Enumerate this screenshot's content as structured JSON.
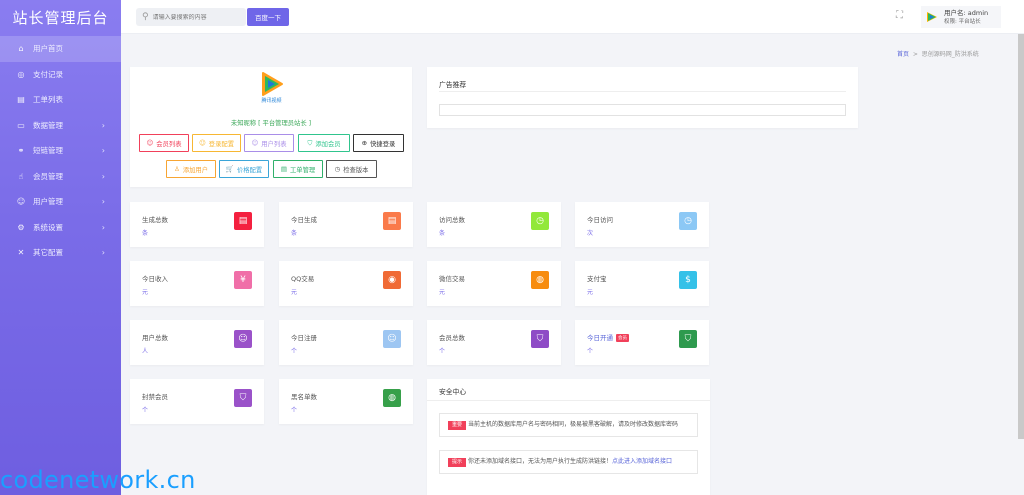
{
  "app": {
    "title": "站长管理后台"
  },
  "sidebar": {
    "items": [
      {
        "label": "用户首页",
        "icon": "⌂",
        "icon_name": "home-icon",
        "active": true,
        "has_children": false
      },
      {
        "label": "支付记录",
        "icon": "◎",
        "icon_name": "payment-icon",
        "active": false,
        "has_children": false
      },
      {
        "label": "工单列表",
        "icon": "▤",
        "icon_name": "ticket-icon",
        "active": false,
        "has_children": false
      },
      {
        "label": "数据管理",
        "icon": "▭",
        "icon_name": "data-icon",
        "active": false,
        "has_children": true
      },
      {
        "label": "短链管理",
        "icon": "⚭",
        "icon_name": "link-icon",
        "active": false,
        "has_children": true
      },
      {
        "label": "会员管理",
        "icon": "☝",
        "icon_name": "member-icon",
        "active": false,
        "has_children": true
      },
      {
        "label": "用户管理",
        "icon": "☺",
        "icon_name": "user-icon",
        "active": false,
        "has_children": true
      },
      {
        "label": "系统设置",
        "icon": "⚙",
        "icon_name": "settings-icon",
        "active": false,
        "has_children": true
      },
      {
        "label": "其它配置",
        "icon": "✕",
        "icon_name": "tools-icon",
        "active": false,
        "has_children": true
      }
    ]
  },
  "topbar": {
    "search_placeholder": "请输入要搜索的内容",
    "search_button": "百度一下",
    "user_name": "用户名: admin",
    "user_role": "权限: 平台站长"
  },
  "breadcrumb": {
    "home": "首页",
    "sep": ">",
    "current": "思创源码网_防洪系统"
  },
  "profile": {
    "logo_caption": "腾讯视频",
    "nickname": "未知昵称 [ 平台管理员站长 ]",
    "buttons": [
      {
        "label": "会员列表",
        "icon": "☺",
        "icon_name": "member-list-icon",
        "color": "#f1405a"
      },
      {
        "label": "登录配置",
        "icon": "☺",
        "icon_name": "login-config-icon",
        "color": "#f7b733"
      },
      {
        "label": "用户列表",
        "icon": "☺",
        "icon_name": "user-list-icon",
        "color": "#a98ee8"
      },
      {
        "label": "添加会员",
        "icon": "⛉",
        "icon_name": "add-member-icon",
        "color": "#30c48d"
      },
      {
        "label": "快捷登录",
        "icon": "⊕",
        "icon_name": "quick-login-icon",
        "color": "#333333"
      },
      {
        "label": "添加用户",
        "icon": "♙",
        "icon_name": "add-user-icon",
        "color": "#f7a533"
      },
      {
        "label": "价格配置",
        "icon": "🛒",
        "icon_name": "price-config-icon",
        "color": "#3aa5d8"
      },
      {
        "label": "工单管理",
        "icon": "▤",
        "icon_name": "ticket-manage-icon",
        "color": "#30b06b"
      },
      {
        "label": "检查版本",
        "icon": "◷",
        "icon_name": "check-version-icon",
        "color": "#555555"
      }
    ]
  },
  "ad": {
    "title": "广告推荐"
  },
  "stats": [
    {
      "title": "生成总数",
      "value": "条",
      "icon": "▤",
      "icon_name": "total-generate-icon",
      "color": "#f4203f"
    },
    {
      "title": "今日生成",
      "value": "条",
      "icon": "▤",
      "icon_name": "today-generate-icon",
      "color": "#fa7a4a"
    },
    {
      "title": "访问总数",
      "value": "条",
      "icon": "◷",
      "icon_name": "total-visit-icon",
      "color": "#92e83a"
    },
    {
      "title": "今日访问",
      "value": "次",
      "icon": "◷",
      "icon_name": "today-visit-icon",
      "color": "#8cc8f5"
    },
    {
      "title": "今日收入",
      "value": "元",
      "icon": "¥",
      "icon_name": "today-income-icon",
      "color": "#f06fa8"
    },
    {
      "title": "QQ交易",
      "value": "元",
      "icon": "◉",
      "icon_name": "qq-trade-icon",
      "color": "#f06a35"
    },
    {
      "title": "微信交易",
      "value": "元",
      "icon": "◍",
      "icon_name": "wechat-trade-icon",
      "color": "#f78c0e"
    },
    {
      "title": "支付宝",
      "value": "元",
      "icon": "$",
      "icon_name": "alipay-icon",
      "color": "#34c1e8"
    },
    {
      "title": "用户总数",
      "value": "人",
      "icon": "☺",
      "icon_name": "total-users-icon",
      "color": "#9a52c9"
    },
    {
      "title": "今日注册",
      "value": "个",
      "icon": "☺",
      "icon_name": "today-register-icon",
      "color": "#9dc6f2"
    },
    {
      "title": "会员总数",
      "value": "个",
      "icon": "⛉",
      "icon_name": "total-members-icon",
      "color": "#8e4bc6"
    },
    {
      "title": "今日开通",
      "value": "个",
      "icon": "⛉",
      "icon_name": "today-open-icon",
      "color": "#2e9a4e",
      "badge": "会员",
      "title_color": "#5864d8"
    },
    {
      "title": "封禁会员",
      "value": "个",
      "icon": "⛉",
      "icon_name": "banned-members-icon",
      "color": "#9a52c9"
    },
    {
      "title": "黑名单数",
      "value": "个",
      "icon": "◍",
      "icon_name": "blacklist-icon",
      "color": "#37a04a"
    }
  ],
  "security": {
    "title": "安全中心",
    "items": [
      {
        "tag": "重要",
        "text": "当前主机的数据库用户名与密码相同，极易被黑客破解，请及时修改数据库密码",
        "link": ""
      },
      {
        "tag": "提示",
        "text": "你还未添加域名接口，无法为用户执行生成防洪链接！",
        "link": "点此进入添加域名接口"
      }
    ]
  },
  "watermark": "codenetwork.cn"
}
